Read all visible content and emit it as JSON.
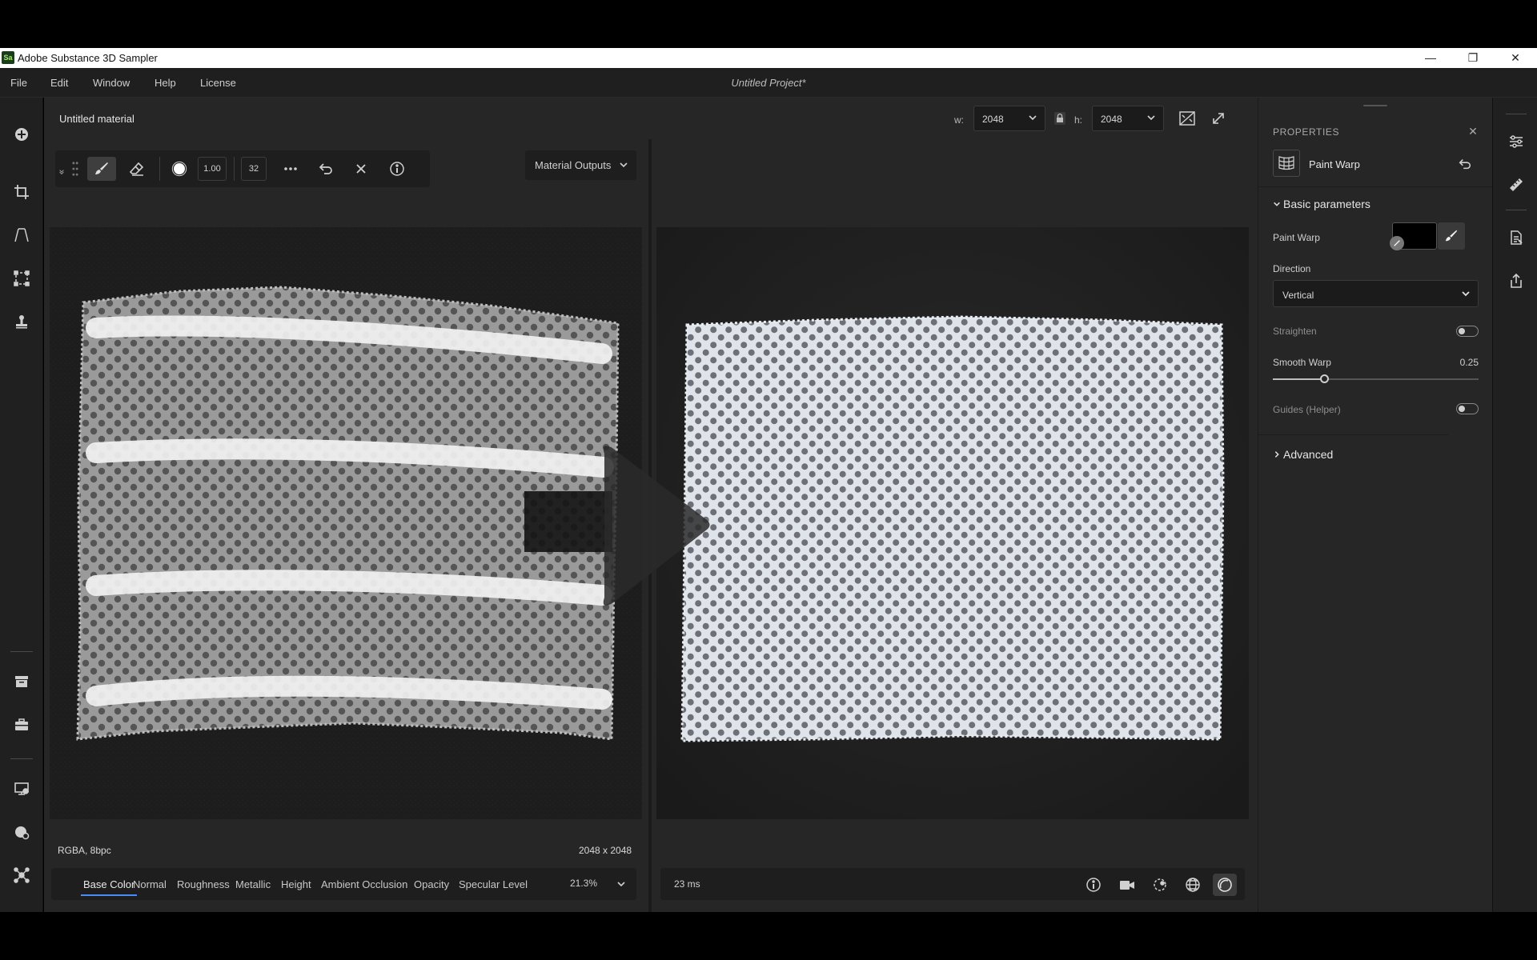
{
  "app": {
    "title": "Adobe Substance 3D Sampler",
    "logo_text": "Sa",
    "project": "Untitled Project*"
  },
  "menu": [
    "File",
    "Edit",
    "Window",
    "Help",
    "License"
  ],
  "document": {
    "material_name": "Untitled material",
    "width_label": "w:",
    "width_value": "2048",
    "height_label": "h:",
    "height_value": "2048"
  },
  "brush_toolbar": {
    "opacity_value": "1.00",
    "size_value": "32"
  },
  "material_outputs_label": "Material Outputs",
  "left_view": {
    "format": "RGBA, 8bpc",
    "resolution": "2048 x 2048",
    "channels": [
      "Base Color",
      "Normal",
      "Roughness",
      "Metallic",
      "Height",
      "Ambient Occlusion",
      "Opacity",
      "Specular Level"
    ],
    "active_channel": "Base Color",
    "zoom": "21.3%"
  },
  "right_view": {
    "render_time": "23 ms"
  },
  "properties": {
    "panel_title": "PROPERTIES",
    "node_name": "Paint Warp",
    "basic_section": "Basic parameters",
    "paint_warp_label": "Paint Warp",
    "direction_label": "Direction",
    "direction_value": "Vertical",
    "straighten_label": "Straighten",
    "straighten_on": false,
    "smooth_warp_label": "Smooth Warp",
    "smooth_warp_value": "0.25",
    "smooth_warp_fraction": 0.25,
    "guides_label": "Guides (Helper)",
    "guides_on": false,
    "advanced_section": "Advanced"
  },
  "colors": {
    "accent": "#4a8cf7",
    "panel": "#262626",
    "toolbar": "#202020"
  },
  "icons": {
    "left_toolbar": [
      "add-icon",
      "crop-icon",
      "perspective-icon",
      "transform-icon",
      "stamp-icon",
      "archive-icon",
      "toolbox-icon",
      "display-icon",
      "material-settings-icon",
      "nodes-icon"
    ],
    "right_toolbar": [
      "properties-icon",
      "measure-icon",
      "export-doc-icon",
      "share-icon"
    ]
  }
}
